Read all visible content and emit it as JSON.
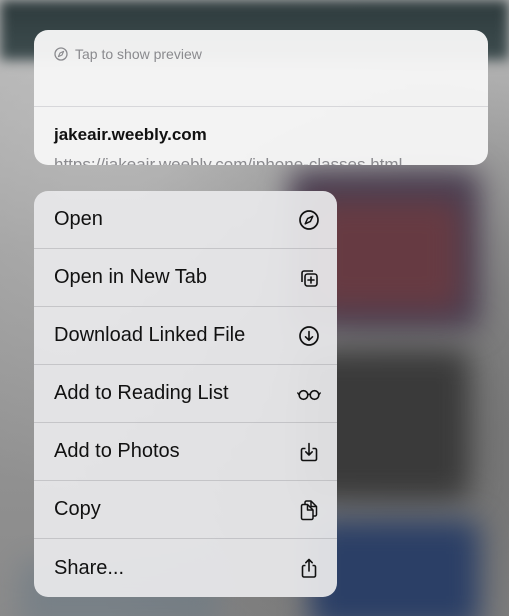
{
  "preview": {
    "hint": "Tap to show preview",
    "hint_icon": "compass-icon",
    "title": "jakeair.weebly.com",
    "url": "https://jakeair.weebly.com/iphone-classes.html"
  },
  "menu": {
    "items": [
      {
        "label": "Open",
        "icon": "compass-icon"
      },
      {
        "label": "Open in New Tab",
        "icon": "new-tab-icon"
      },
      {
        "label": "Download Linked File",
        "icon": "download-icon"
      },
      {
        "label": "Add to Reading List",
        "icon": "glasses-icon"
      },
      {
        "label": "Add to Photos",
        "icon": "save-to-photos-icon"
      },
      {
        "label": "Copy",
        "icon": "copy-icon"
      },
      {
        "label": "Share...",
        "icon": "share-icon"
      }
    ]
  },
  "colors": {
    "text_primary": "#111111",
    "text_secondary": "#8a8a8e",
    "menu_bg": "#e8e8ea",
    "card_bg": "#f5f5f5"
  }
}
